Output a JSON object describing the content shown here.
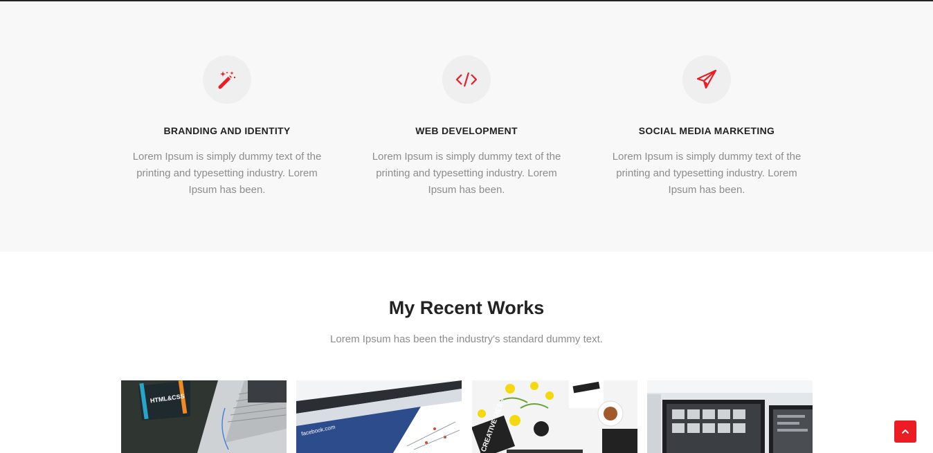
{
  "services": [
    {
      "icon": "magic-wand-icon",
      "title": "BRANDING AND IDENTITY",
      "description": "Lorem Ipsum is simply dummy text of the printing and typesetting industry. Lorem Ipsum has been."
    },
    {
      "icon": "code-icon",
      "title": "WEB DEVELOPMENT",
      "description": "Lorem Ipsum is simply dummy text of the printing and typesetting industry. Lorem Ipsum has been."
    },
    {
      "icon": "paper-plane-icon",
      "title": "SOCIAL MEDIA MARKETING",
      "description": "Lorem Ipsum is simply dummy text of the printing and typesetting industry. Lorem Ipsum has been."
    }
  ],
  "works": {
    "title": "My Recent Works",
    "subtitle": "Lorem Ipsum has been the industry's standard dummy text.",
    "items": [
      {
        "image_label": "HTML&CSS"
      },
      {
        "image_label": "facebook.com"
      },
      {
        "image_label": "CREATIVE MESS"
      },
      {
        "image_label": ""
      }
    ]
  },
  "scroll_top": {
    "icon": "chevron-up-icon"
  },
  "colors": {
    "accent": "#ec1c24",
    "heading": "#222222",
    "body_text": "#8c8c8c",
    "section_bg": "#f8f8f8",
    "icon_bg": "#efefef"
  }
}
